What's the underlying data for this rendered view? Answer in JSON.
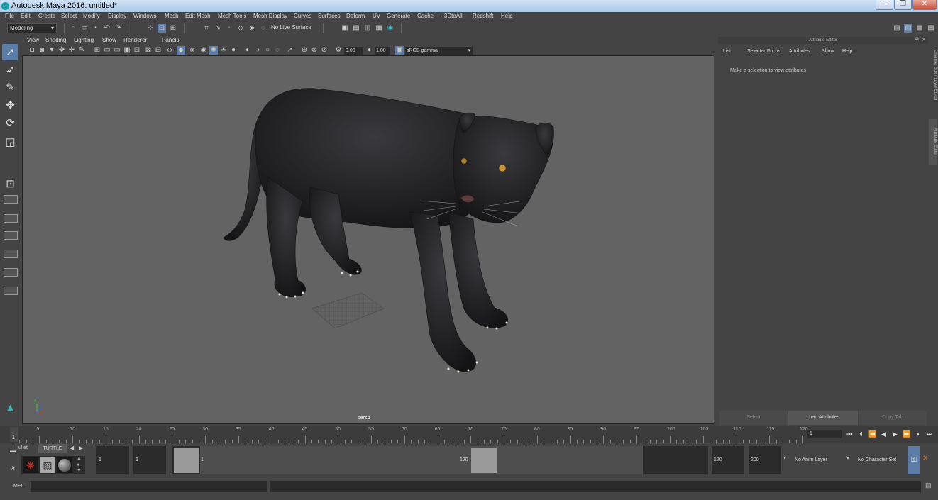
{
  "window": {
    "title": "Autodesk Maya 2016: untitled*",
    "minimize": "–",
    "maximize": "❐",
    "close": "✕"
  },
  "menubar": [
    "File",
    "Edit",
    "Create",
    "Select",
    "Modify",
    "Display",
    "Windows",
    "Mesh",
    "Edit Mesh",
    "Mesh Tools",
    "Mesh Display",
    "Curves",
    "Surfaces",
    "Deform",
    "UV",
    "Generate",
    "Cache",
    "- 3DtoAll -",
    "Redshift",
    "Help"
  ],
  "statusline": {
    "mode": "Modeling",
    "live_surface": "No Live Surface"
  },
  "viewport_menu": [
    "View",
    "Shading",
    "Lighting",
    "Show",
    "Renderer",
    "Panels"
  ],
  "viewport_toolbar": {
    "exposure": "0.00",
    "gamma": "1.00",
    "color_space": "sRGB gamma"
  },
  "viewport": {
    "camera_label": "persp",
    "axis_x": "x",
    "axis_y": "y",
    "axis_z": "z"
  },
  "attribute_editor": {
    "header": "Attribute Editor",
    "menu": [
      "List",
      "Selected",
      "Focus",
      "Attributes",
      "Show",
      "Help"
    ],
    "message": "Make a selection to view attributes",
    "buttons": {
      "select": "Select",
      "load": "Load Attributes",
      "copy": "Copy Tab"
    }
  },
  "side_tabs": {
    "channel_box": "Channel Box / Layer Editor",
    "attribute_editor": "Attribute Editor"
  },
  "timeline": {
    "ticks": [
      "5",
      "10",
      "15",
      "20",
      "25",
      "30",
      "35",
      "40",
      "45",
      "50",
      "55",
      "60",
      "65",
      "70",
      "75",
      "80",
      "85",
      "90",
      "95",
      "100",
      "105",
      "110",
      "115",
      "120"
    ],
    "current_frame_marker": "1",
    "current_frame": "1"
  },
  "range": {
    "shelf_tabs": {
      "bullet": "ullet",
      "turtle": "TURTLE"
    },
    "start": "1",
    "range_start": "1",
    "slider_start_label": "1",
    "slider_end_label": "120",
    "range_end": "120",
    "end": "200",
    "anim_layer": "No Anim Layer",
    "character_set": "No Character Set"
  },
  "cmdline": {
    "label": "MEL"
  },
  "colors": {
    "accent": "#5a7ea8",
    "panel_bg": "#444444",
    "viewport_bg": "#636363",
    "title_gradient_top": "#cfe3f5"
  }
}
